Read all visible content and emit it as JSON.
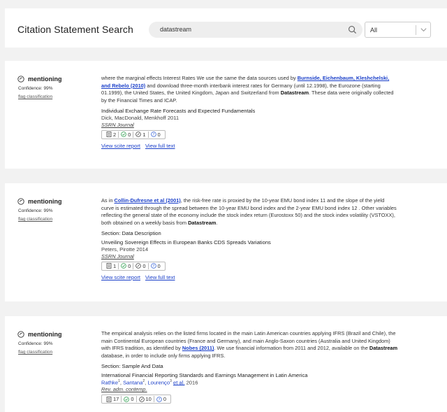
{
  "header": {
    "title": "Citation Statement Search",
    "search_value": "datastream",
    "filter_value": "All"
  },
  "cards": [
    {
      "classification": "mentioning",
      "confidence": "Confidence: 99%",
      "flag": "flag classification",
      "snippet": {
        "pre": "where the marginal effects Interest Rates We use the same the data sources used by ",
        "link": "Burnside, Eichenbaum, Kleshchelski, and Rebelo (2010)",
        "mid": " and download three-month interbank interest rates for Germany (until 12.1998), the Eurozone (starting 01.1999), the United States, the United Kingdom, Japan and Switzerland from ",
        "bold": "Datastream",
        "post": ". These data were originally collected by the Financial Times and ICAP."
      },
      "section": "",
      "paper_title": "Individual Exchange Rate Forecasts and Expected Fundamentals",
      "authors": "Dick, MacDonald, Menkhoff 2011",
      "journal": "SSRN Journal",
      "counts": {
        "citing": "2",
        "supporting": "0",
        "mentioning": "1",
        "contrasting": "0"
      },
      "link_report": "View scite report",
      "link_full": "View full text"
    },
    {
      "classification": "mentioning",
      "confidence": "Confidence: 99%",
      "flag": "flag classification",
      "snippet": {
        "pre": "As in ",
        "link": "Collin-Dufresne et al (2001)",
        "mid": ", the risk-free rate is proxied by the 10-year EMU bond index 11 and the slope of the yield curve is estimated through the spread between the 10-year EMU bond index and the 2-year EMU bond index 12 . Other variables reflecting the general state of the economy include the stock index return (Eurostoxx 50) and the stock index volatility (VSTOXX), both obtained on a weekly basis from ",
        "bold": "Datastream",
        "post": "."
      },
      "section": "Section: Data Description",
      "paper_title": "Unveiling Sovereign Effects in European Banks CDS Spreads Variations",
      "authors": "Peters, Pirotte 2014",
      "journal": "SSRN Journal",
      "counts": {
        "citing": "1",
        "supporting": "0",
        "mentioning": "0",
        "contrasting": "0"
      },
      "link_report": "View scite report",
      "link_full": "View full text"
    },
    {
      "classification": "mentioning",
      "confidence": "Confidence: 99%",
      "flag": "flag classification",
      "snippet": {
        "pre": "The empirical analysis relies on the listed firms located in the main Latin American countries applying IFRS (Brazil and Chile), the main Continental European countries (France and Germany), and main Anglo-Saxon countries (Australia and United Kingdom) with IFRS tradition, as identified by ",
        "link": "Nobes (2011)",
        "mid": ". We use financial information from 2011 and 2012, available on the ",
        "bold": "Datastream",
        "post": " database, in order to include only firms applying IFRS."
      },
      "section": "Section: Sample And Data",
      "paper_title": "International Financial Reporting Standards and Earnings Management in Latin America",
      "authors_linked": [
        "Rathke",
        "Santana",
        "Lourenço"
      ],
      "authors_sup": [
        "1",
        "2",
        "3"
      ],
      "authors_etal": "et al.",
      "authors_year": "2016",
      "journal": "Rev. adm. contemp.",
      "counts": {
        "citing": "17",
        "supporting": "0",
        "mentioning": "10",
        "contrasting": "0"
      }
    }
  ],
  "colors": {
    "link": "#1a3fc9",
    "supporting": "#2e9e4f",
    "contrasting": "#3a66d6"
  },
  "icons": [
    "search-icon",
    "chevron-down-icon",
    "check-circle-icon",
    "document-icon",
    "supporting-icon",
    "mentioning-icon",
    "contrasting-icon"
  ]
}
